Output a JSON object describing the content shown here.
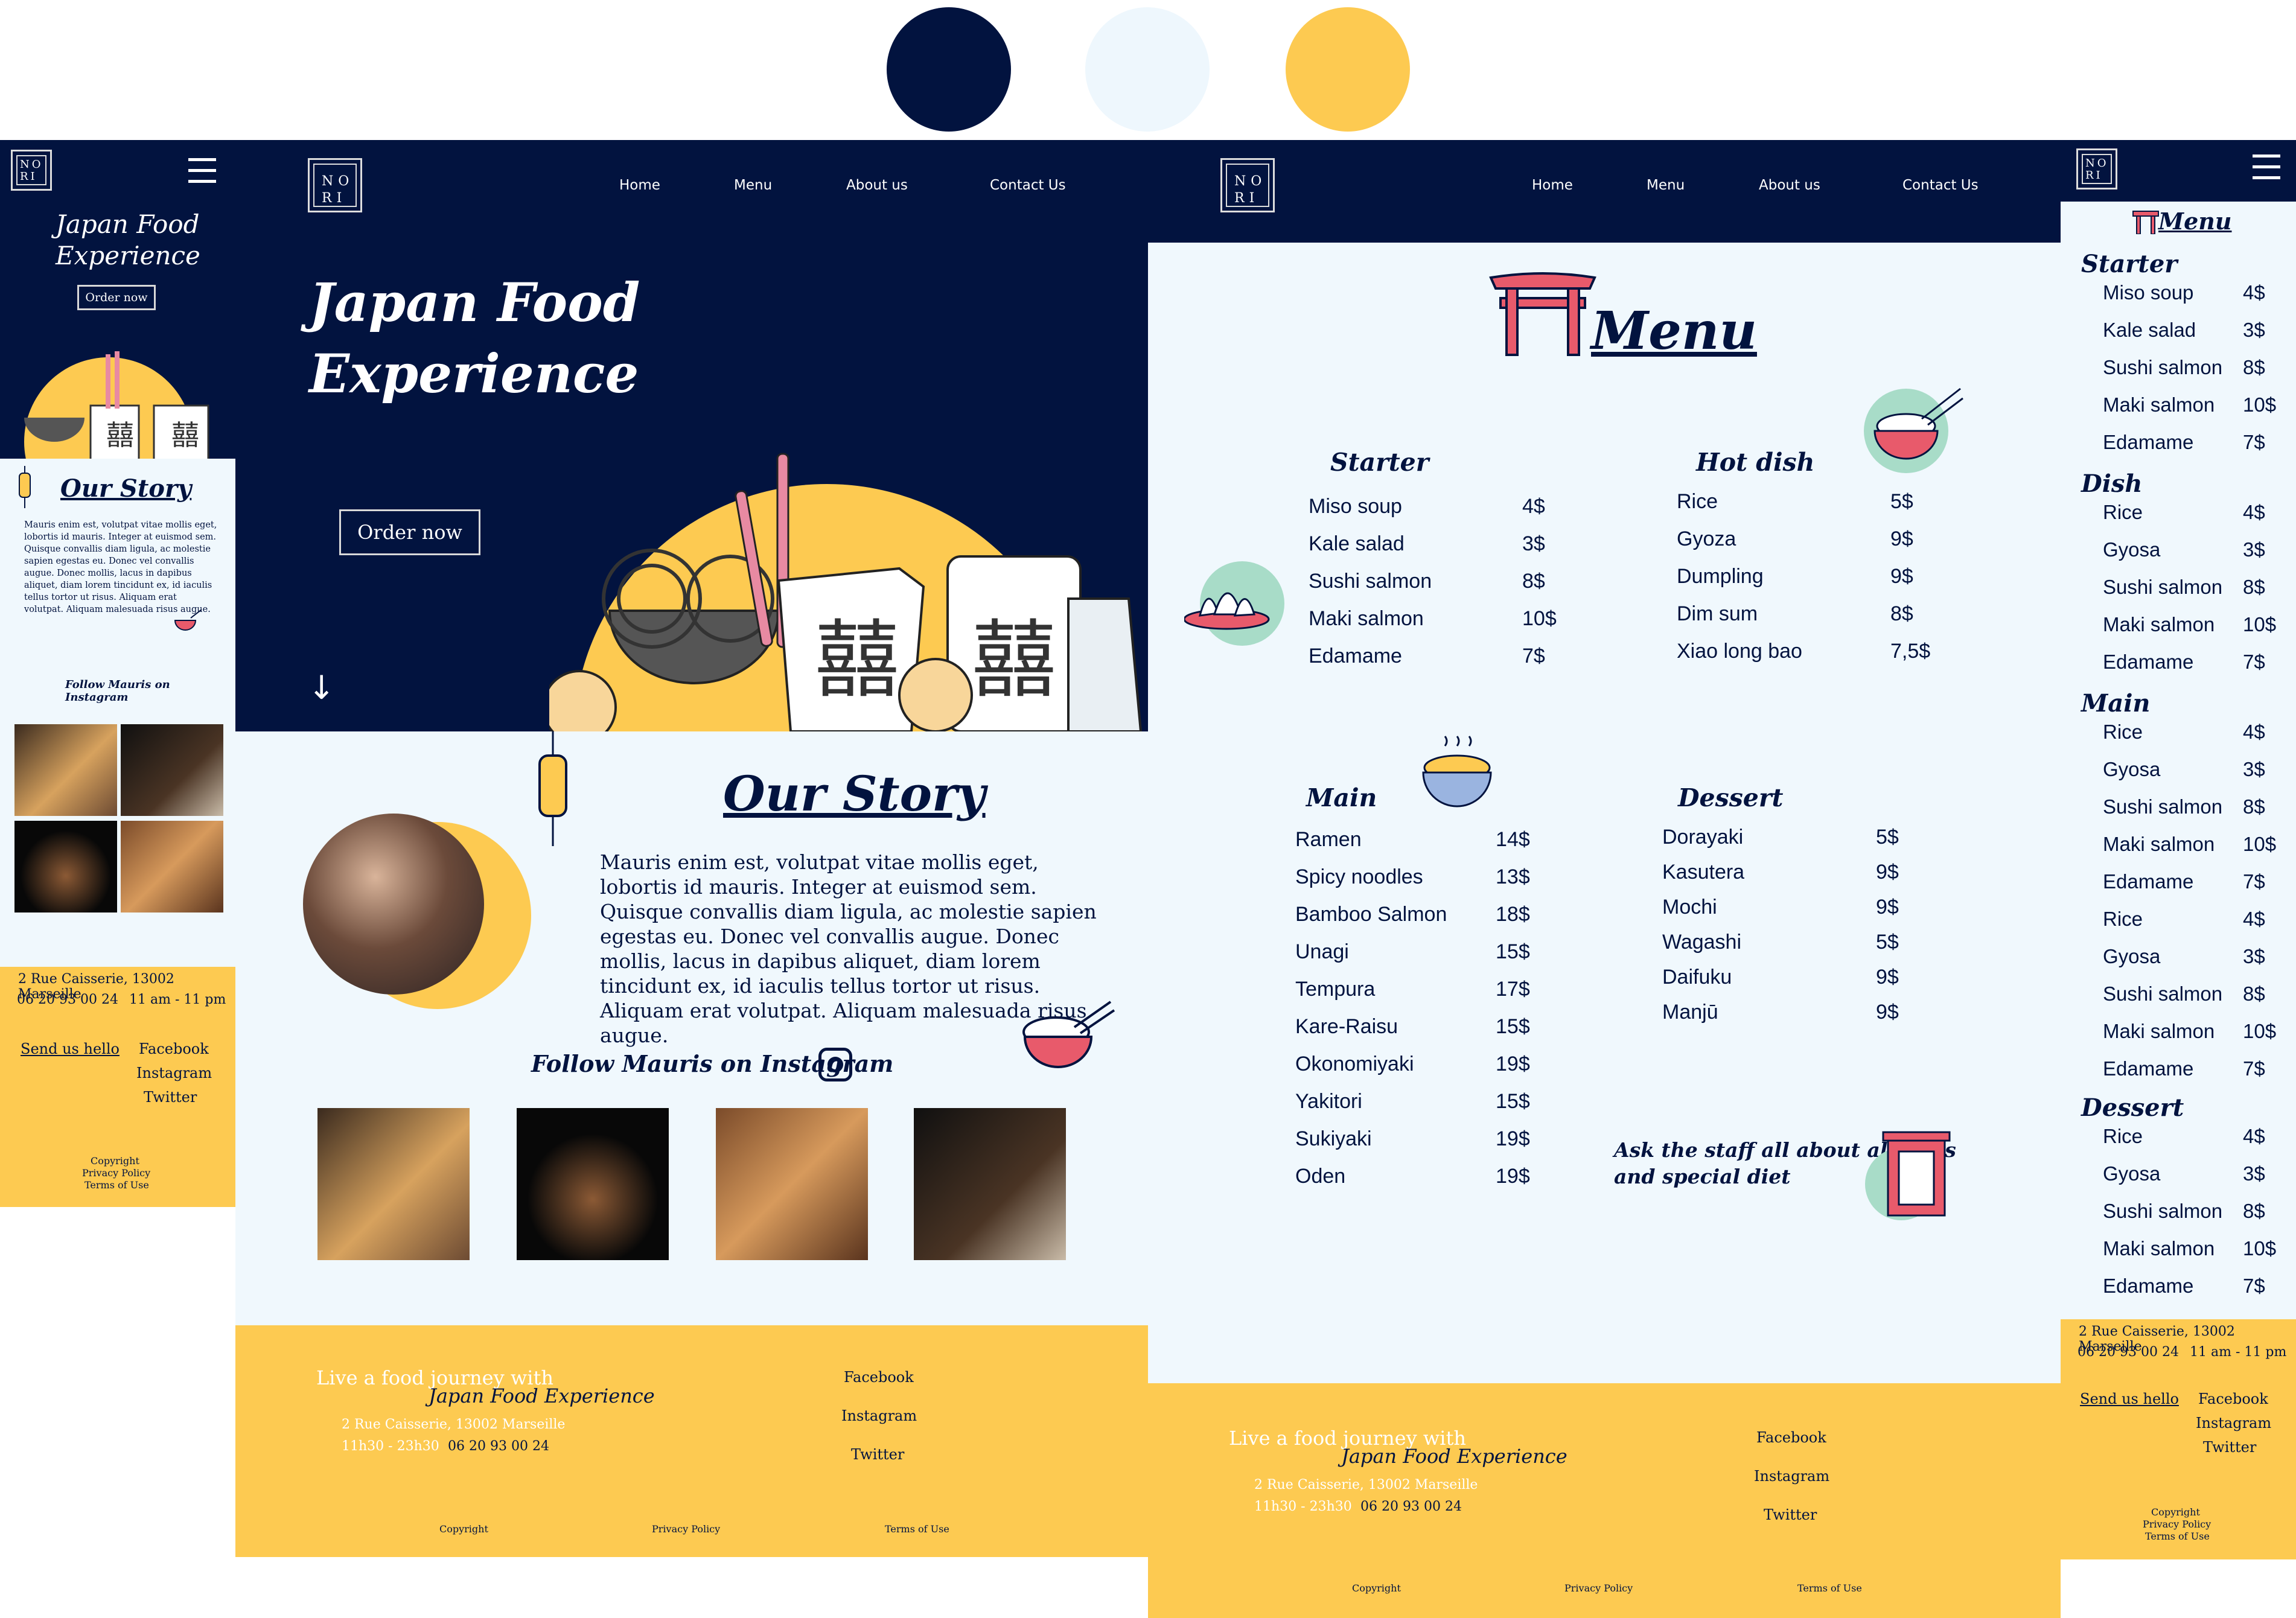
{
  "palette": {
    "navy": "#02133f",
    "ice": "#f0f8fd",
    "yellow": "#fdca51"
  },
  "brand": {
    "logo_line1": "NO",
    "logo_line2": "RI"
  },
  "nav": {
    "home": "Home",
    "menu": "Menu",
    "about": "About us",
    "contact": "Contact Us"
  },
  "hero": {
    "line1": "Japan Food",
    "line2": "Experience",
    "cta": "Order now"
  },
  "story": {
    "title": "Our Story",
    "body": "Mauris enim est, volutpat vitae mollis eget, lobortis id mauris. Integer at euismod sem. Quisque convallis diam ligula, ac molestie sapien egestas eu. Donec vel convallis augue. Donec mollis, lacus in dapibus aliquet, diam lorem tincidunt ex, id iaculis tellus tortor ut risus. Aliquam erat volutpat. Aliquam malesuada risus augue.",
    "instagram": "Follow Mauris on Instagram"
  },
  "footer": {
    "tagline": "Live a food journey with",
    "tagline_brand": "Japan Food Experience",
    "address": "2 Rue Caisserie, 13002 Marseille",
    "hours": "11h30 - 23h30",
    "hours_mobile": "11 am - 11 pm",
    "phone": "06 20 93 00 24",
    "send": "Send us hello",
    "facebook": "Facebook",
    "instagram": "Instagram",
    "twitter": "Twitter",
    "copyright": "Copyright",
    "privacy": "Privacy Policy",
    "terms": "Terms of Use"
  },
  "menu_page": {
    "title": "Menu",
    "allergy_line1": "Ask the staff all about alergies",
    "allergy_line2": "and special diet",
    "starter": {
      "title": "Starter",
      "items": [
        [
          "Miso soup",
          "4$"
        ],
        [
          "Kale salad",
          "3$"
        ],
        [
          "Sushi salmon",
          "8$"
        ],
        [
          "Maki salmon",
          "10$"
        ],
        [
          "Edamame",
          "7$"
        ]
      ]
    },
    "hot": {
      "title": "Hot dish",
      "items": [
        [
          "Rice",
          "5$"
        ],
        [
          "Gyoza",
          "9$"
        ],
        [
          "Dumpling",
          "9$"
        ],
        [
          "Dim sum",
          "8$"
        ],
        [
          "Xiao long bao",
          "7,5$"
        ]
      ]
    },
    "main": {
      "title": "Main",
      "items": [
        [
          "Ramen",
          "14$"
        ],
        [
          "Spicy noodles",
          "13$"
        ],
        [
          "Bamboo Salmon",
          "18$"
        ],
        [
          "Unagi",
          "15$"
        ],
        [
          "Tempura",
          "17$"
        ],
        [
          "Kare-Raisu",
          "15$"
        ],
        [
          "Okonomiyaki",
          "19$"
        ],
        [
          "Yakitori",
          "15$"
        ],
        [
          "Sukiyaki",
          "19$"
        ],
        [
          "Oden",
          "19$"
        ]
      ]
    },
    "dessert": {
      "title": "Dessert",
      "items": [
        [
          "Dorayaki",
          "5$"
        ],
        [
          "Kasutera",
          "9$"
        ],
        [
          "Mochi",
          "9$"
        ],
        [
          "Wagashi",
          "5$"
        ],
        [
          "Daifuku",
          "9$"
        ],
        [
          "Manjū",
          "9$"
        ]
      ]
    }
  },
  "mobile_menu": {
    "title": "Menu",
    "starter": {
      "title": "Starter",
      "items": [
        [
          "Miso soup",
          "4$"
        ],
        [
          "Kale salad",
          "3$"
        ],
        [
          "Sushi salmon",
          "8$"
        ],
        [
          "Maki salmon",
          "10$"
        ],
        [
          "Edamame",
          "7$"
        ]
      ]
    },
    "dish": {
      "title": "Dish",
      "items": [
        [
          "Rice",
          "4$"
        ],
        [
          "Gyosa",
          "3$"
        ],
        [
          "Sushi salmon",
          "8$"
        ],
        [
          "Maki salmon",
          "10$"
        ],
        [
          "Edamame",
          "7$"
        ]
      ]
    },
    "main": {
      "title": "Main",
      "items": [
        [
          "Rice",
          "4$"
        ],
        [
          "Gyosa",
          "3$"
        ],
        [
          "Sushi salmon",
          "8$"
        ],
        [
          "Maki salmon",
          "10$"
        ],
        [
          "Edamame",
          "7$"
        ],
        [
          "Rice",
          "4$"
        ],
        [
          "Gyosa",
          "3$"
        ],
        [
          "Sushi salmon",
          "8$"
        ],
        [
          "Maki salmon",
          "10$"
        ],
        [
          "Edamame",
          "7$"
        ]
      ]
    },
    "dessert": {
      "title": "Dessert",
      "items": [
        [
          "Rice",
          "4$"
        ],
        [
          "Gyosa",
          "3$"
        ],
        [
          "Sushi salmon",
          "8$"
        ],
        [
          "Maki salmon",
          "10$"
        ],
        [
          "Edamame",
          "7$"
        ]
      ]
    }
  }
}
